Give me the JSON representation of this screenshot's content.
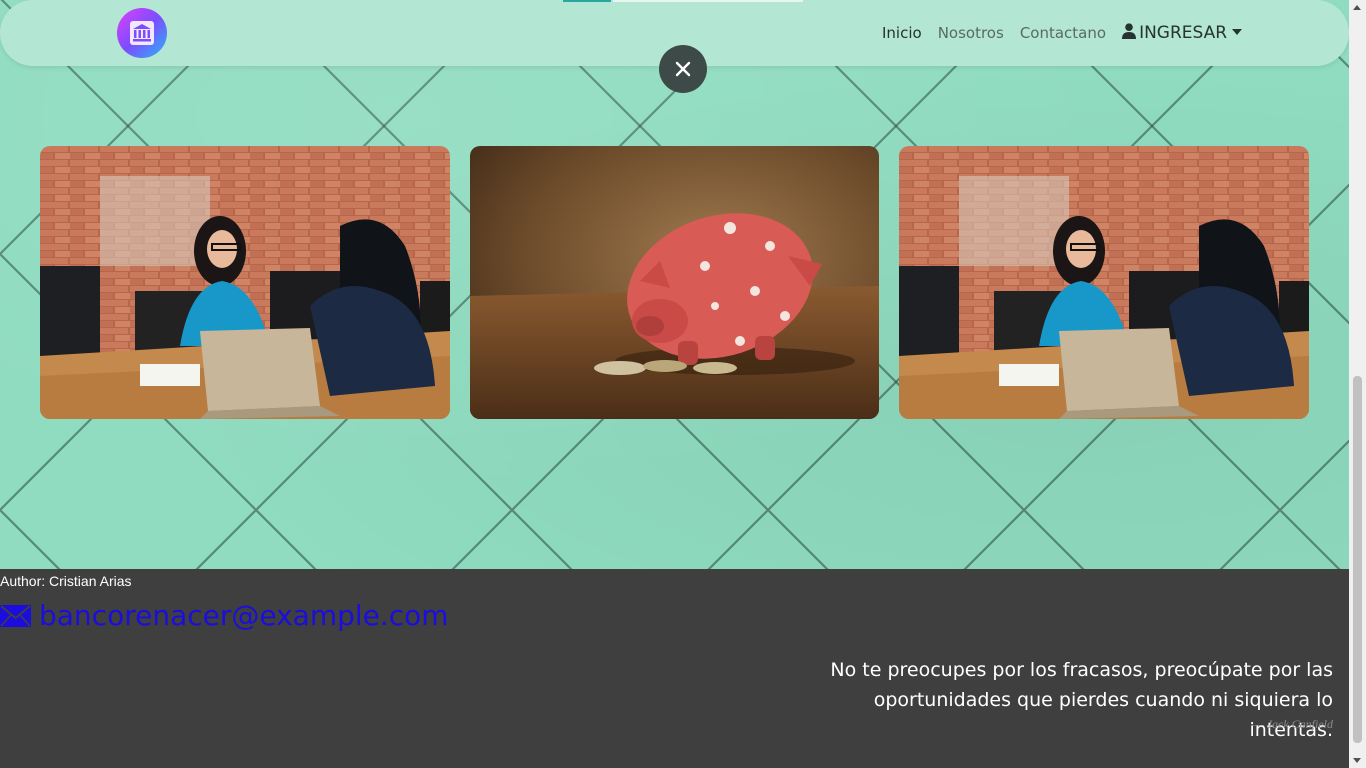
{
  "navbar": {
    "logo_icon": "bank-building-icon",
    "links": [
      {
        "label": "Inicio",
        "active": true
      },
      {
        "label": "Nosotros",
        "active": false
      },
      {
        "label": "Contactano",
        "active": false
      }
    ],
    "dropdown_label": "INGRESAR",
    "dropdown_icon": "user-icon"
  },
  "modal": {
    "close_icon": "close-icon"
  },
  "carousel": {
    "images": [
      {
        "subject": "two women meeting at a desk with laptop"
      },
      {
        "subject": "pink piggy bank with coins"
      },
      {
        "subject": "two women meeting at a desk with laptop"
      }
    ]
  },
  "footer": {
    "author": "Author: Cristian Arias",
    "email": "bancorenacer@example.com",
    "email_icon": "envelope-icon",
    "quote": "No te preocupes por los fracasos, preocúpate por las oportunidades que pierdes cuando ni siquiera lo intentas.",
    "cite_dash": "—",
    "cite_author": "Jack Canfield"
  },
  "colors": {
    "background": "#8fdcc0",
    "navbar": "#b3e6d3",
    "footer": "#3f3f3f",
    "email_link": "#1a0dde",
    "close_button": "#3e4a47"
  }
}
